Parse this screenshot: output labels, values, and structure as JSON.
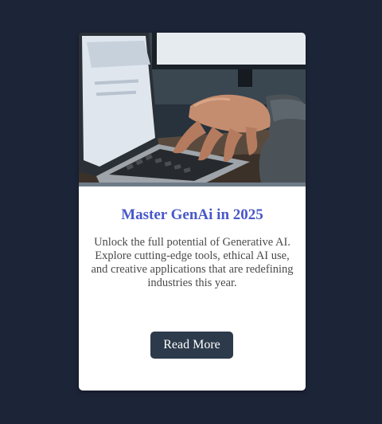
{
  "card": {
    "image_alt": "Hands typing on a laptop keyboard",
    "title": "Master GenAi in 2025",
    "description": "Unlock the full potential of Generative AI. Explore cutting-edge tools, ethical AI use, and creative applications that are redefining industries this year.",
    "button_label": "Read More"
  },
  "colors": {
    "page_background": "#1c2438",
    "card_background": "#ffffff",
    "title": "#4858c8",
    "description": "#4a4a4a",
    "button_background": "#2d3a4b",
    "button_text": "#ffffff"
  }
}
